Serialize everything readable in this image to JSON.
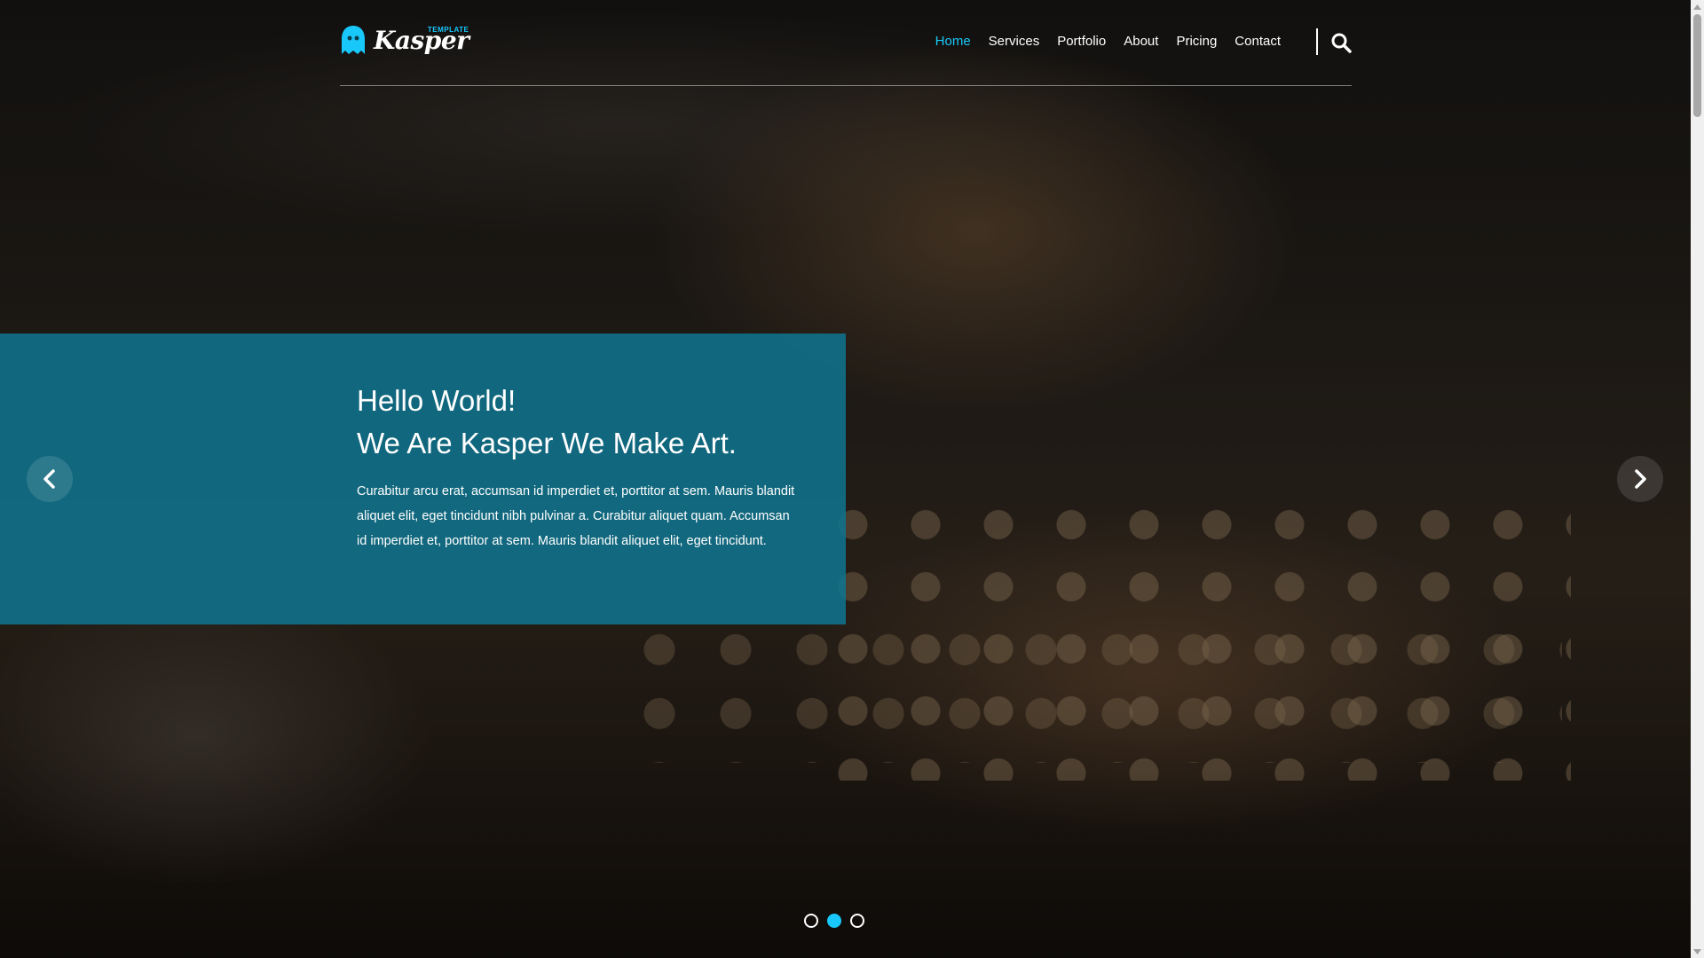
{
  "brand": {
    "name": "Kasper",
    "tagline": "TEMPLATE",
    "accent_color": "#19c8fa"
  },
  "nav": {
    "items": [
      {
        "label": "Home",
        "active": true
      },
      {
        "label": "Services",
        "active": false
      },
      {
        "label": "Portfolio",
        "active": false
      },
      {
        "label": "About",
        "active": false
      },
      {
        "label": "Pricing",
        "active": false
      },
      {
        "label": "Contact",
        "active": false
      }
    ],
    "search_icon": "search-icon"
  },
  "hero": {
    "title_line1": "Hello World!",
    "title_line2": "We Are Kasper We Make Art.",
    "text": "Curabitur arcu erat, accumsan id imperdiet et, porttitor at sem. Mauris blandit aliquet elit, eget tincidunt nibh pulvinar a. Curabitur aliquet quam. Accumsan id imperdiet et, porttitor at sem. Mauris blandit aliquet elit, eget tincidunt.",
    "box_color": "#0f748f",
    "prev_icon": "chevron-left-icon",
    "next_icon": "chevron-right-icon"
  },
  "slider": {
    "count": 3,
    "active_index": 1
  }
}
